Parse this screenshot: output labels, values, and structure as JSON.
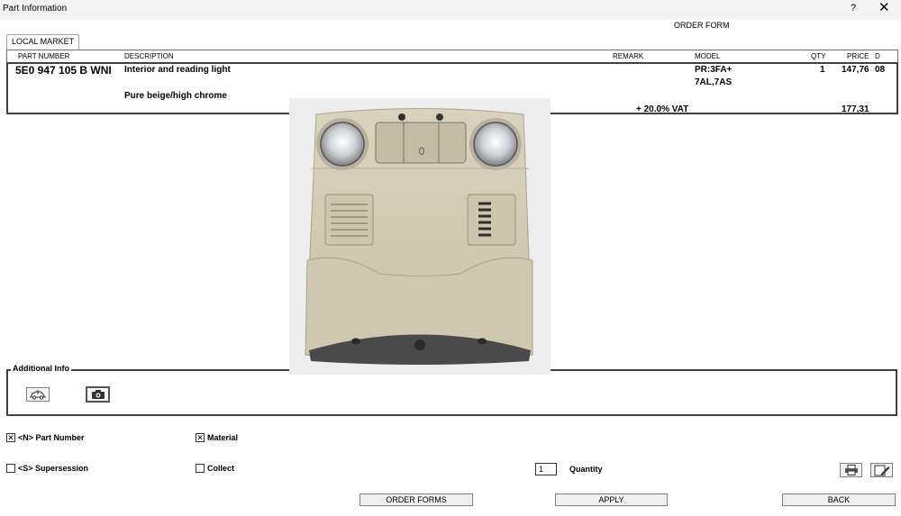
{
  "window": {
    "title": "Part Information",
    "help_label": "?",
    "close_label": "✕"
  },
  "order_form_label": "ORDER FORM",
  "tabs": [
    {
      "label": "LOCAL MARKET"
    }
  ],
  "table": {
    "headers": {
      "part_number": "PART NUMBER",
      "description": "DESCRIPTION",
      "remark": "REMARK",
      "model": "MODEL",
      "qty": "QTY",
      "price": "PRICE",
      "d": "D"
    },
    "row": {
      "part_number": "5E0 947 105 B  WNI",
      "description": "Interior and reading light",
      "model_line1": "PR:3FA+",
      "model_line2": "7AL,7AS",
      "qty": "1",
      "price": "147,76",
      "d": "08",
      "color": "Pure beige/high chrome",
      "vat_label": "+ 20.0% VAT",
      "vat_price": "177,31"
    }
  },
  "photo": {
    "button_label": "0"
  },
  "additional_info": {
    "label": "Additional Info",
    "icons": [
      "car-diagram-icon",
      "camera-icon"
    ]
  },
  "options": {
    "part_number": {
      "label": "<N> Part Number",
      "checked": true
    },
    "supersession": {
      "label": "<S> Supersession",
      "checked": false
    },
    "material": {
      "label": "Material",
      "checked": true
    },
    "collect": {
      "label": "Collect",
      "checked": false
    }
  },
  "quantity": {
    "value": "1",
    "label": "Quantity"
  },
  "buttons": {
    "order_forms": "ORDER FORMS",
    "apply": "APPLY",
    "back": "BACK"
  },
  "right_icons": [
    "print-icon",
    "edit-icon"
  ]
}
